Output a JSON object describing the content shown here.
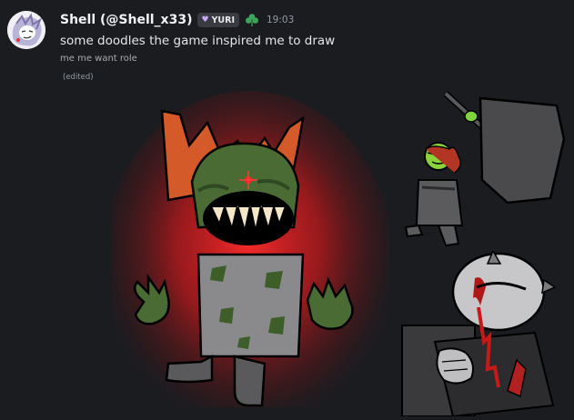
{
  "message": {
    "author": "Shell (@Shell_x33)",
    "tag": {
      "label": "YURI",
      "icon": "heart-icon"
    },
    "role_icon": "clover-icon",
    "timestamp": "19:03",
    "content": "some doodles the game inspired me to draw",
    "subtext": "me me want role",
    "edited_label": "(edited)"
  },
  "attachments": [
    {
      "name": "red-monster-doodle"
    },
    {
      "name": "hammer-character-doodle"
    },
    {
      "name": "grey-character-doodle"
    }
  ],
  "colors": {
    "background": "#1b1c20",
    "username": "#f2f3f5",
    "timestamp": "#949ba4",
    "tag_bg": "#3a3b41",
    "role_green": "#3ba55c"
  }
}
